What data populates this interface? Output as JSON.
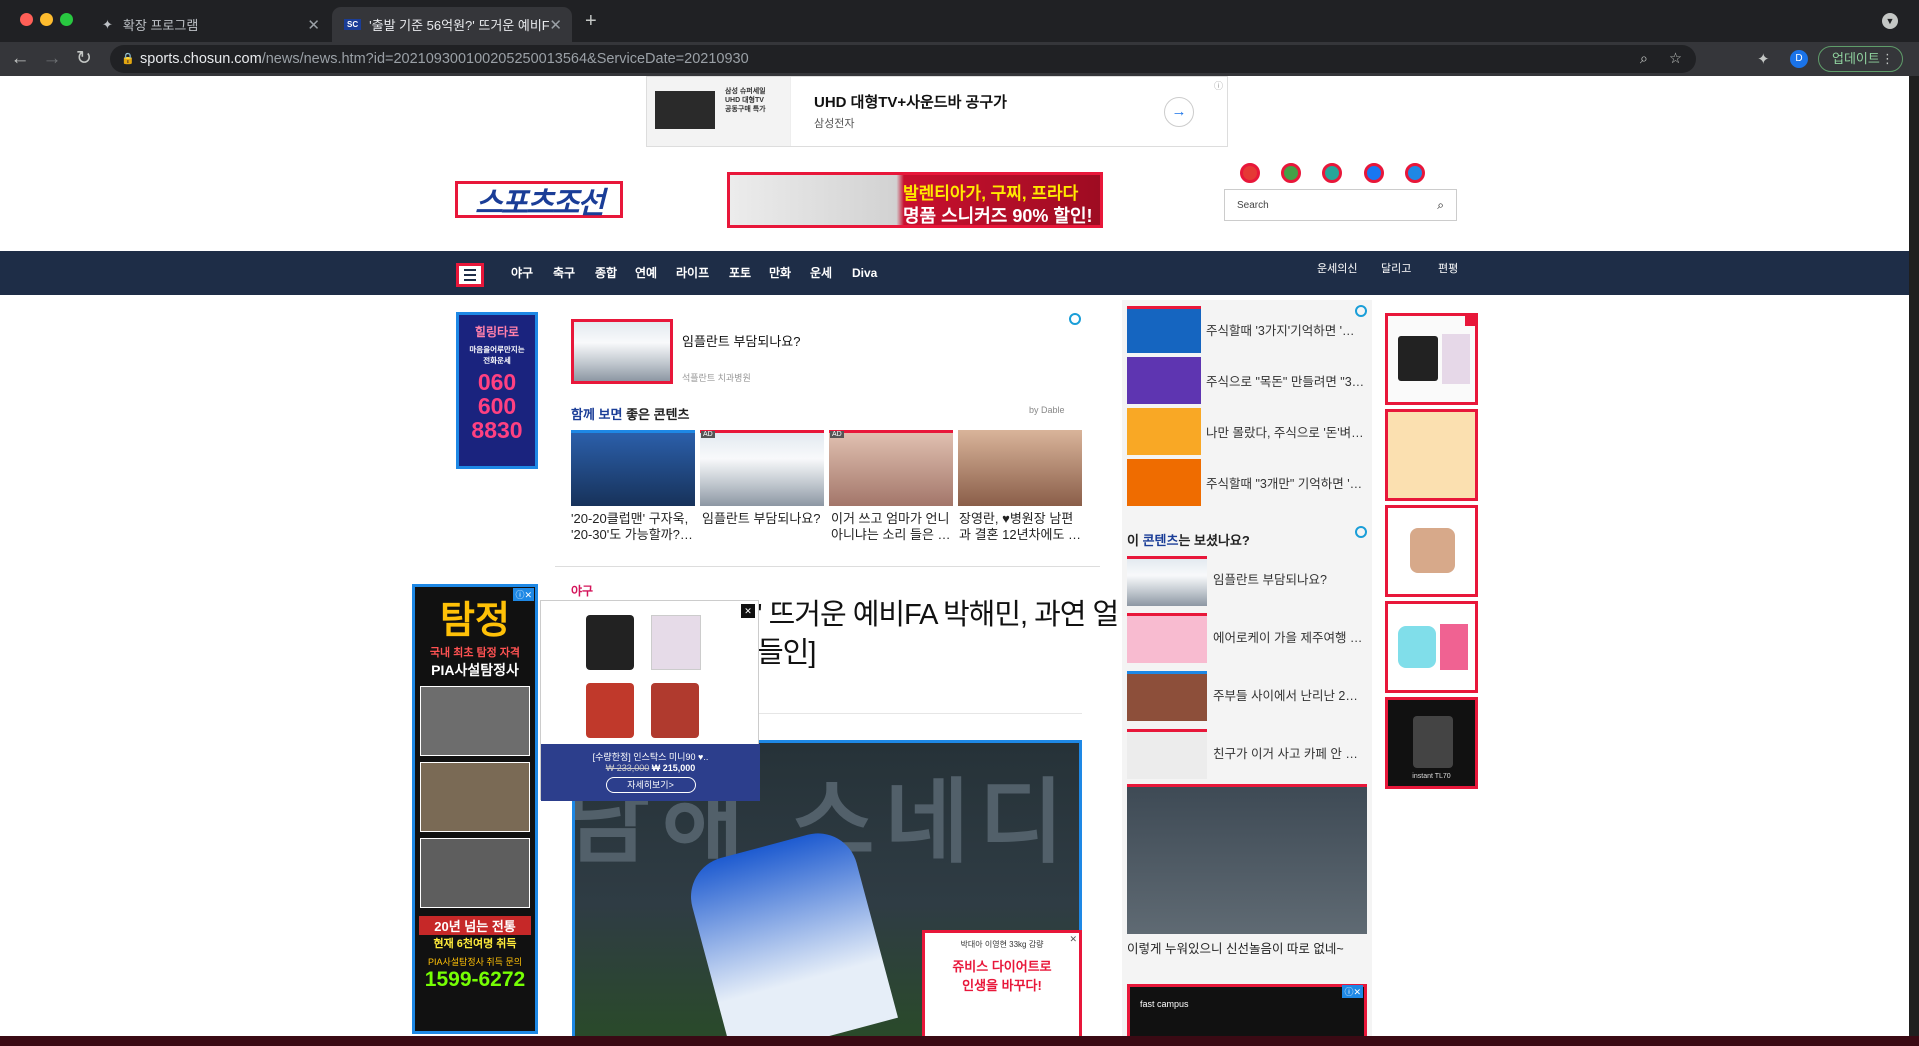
{
  "browser": {
    "tabs": [
      {
        "title": "확장 프로그램",
        "icon": "puzzle-icon"
      },
      {
        "title": "'출발 기준 56억원?' 뜨거운 예비FA",
        "icon": "sc-favicon"
      }
    ],
    "url_host": "sports.chosun.com",
    "url_path": "/news/news.htm?id=202109300100205250013564&ServiceDate=20210930",
    "update_label": "업데이트",
    "profile_letter": "D"
  },
  "top_ad": {
    "title": "UHD 대형TV+사운드바 공구가",
    "advertiser": "삼성전자",
    "thumb_lines": [
      "삼성 슈퍼세일",
      "UHD 대형TV",
      "공동구매 특가"
    ]
  },
  "header": {
    "logo_text": "스포츠조선",
    "banner_line1": "발렌티아가, 구찌, 프라다",
    "banner_line2": "명품 스니커즈 90% 할인!",
    "search_placeholder": "Search"
  },
  "nav": {
    "items": [
      "야구",
      "축구",
      "종합",
      "연예",
      "라이프",
      "포토",
      "만화",
      "운세",
      "Diva"
    ],
    "right_items": [
      "운세의신",
      "달리고",
      "편평"
    ]
  },
  "side_ad": {
    "title": "힐링타로",
    "subtitle": "마음을어루만지는 전화운세",
    "phone": [
      "060",
      "600",
      "8830"
    ]
  },
  "sponsored": {
    "title": "임플란트 부담되나요?",
    "source": "석플란트 치과병원"
  },
  "together": {
    "heading_accent": "함께 보면",
    "heading_rest": "좋은 콘텐츠",
    "by": "by Dable",
    "cards": [
      {
        "title": "'20-20클럽맨' 구자욱, '20-30'도 가능할까?…",
        "ad": false
      },
      {
        "title": "임플란트 부담되나요?",
        "ad": true
      },
      {
        "title": "이거 쓰고 엄마가 언니 아니냐는 소리 들은 …",
        "ad": true
      },
      {
        "title": "장영란, ♥병원장 남편과 결혼 12년차에도 …",
        "ad": false
      }
    ]
  },
  "article": {
    "category": "야구",
    "headline_line1": "' 뜨거운 예비FA 박해민, 과연 얼",
    "headline_line2": "들인]"
  },
  "popup": {
    "label": "[수량한정] 인스탁스 미니90 ♥..",
    "old_price": "₩ 233,000",
    "new_price": "₩ 215,000",
    "cta": "자세히보기>"
  },
  "left_ad": {
    "title": "탐정",
    "line1": "국내 최초 탐정 자격",
    "line2": "PIA사설탐정사",
    "line3": "20년 넘는 전통",
    "line4": "현재 6천여명 취득",
    "line5": "PIA사설탐정사 취득 문의",
    "phone": "1599-6272"
  },
  "inset_ad": {
    "caption": "박대아 이영현 33kg 감량",
    "title_line1": "쥬비스 다이어트로",
    "title_line2": "인생을 바꾸다!"
  },
  "right_list": [
    "주식할때 '3가지'기억하면 '…",
    "주식으로 \"목돈\" 만들려면 \"3…",
    "나만 몰랐다, 주식으로 '돈'벼…",
    "주식할때 \"3개만\" 기억하면 '…"
  ],
  "seen": {
    "heading_prefix": "이",
    "heading_accent": "콘텐츠",
    "heading_rest": "는 보셨나요?",
    "items": [
      "임플란트 부담되나요?",
      "에어로케이 가을 제주여행 …",
      "주부들 사이에서 난리난 2…",
      "친구가 이거 사고 카페 안 …"
    ],
    "feature_caption": "이렇게 누워있으니 신선놀음이 따로 없네~",
    "bottom_ad_label": "fast campus"
  },
  "far_right": {
    "last_label": "instant TL70"
  },
  "colors": {
    "nav_bg": "#1e2d47",
    "accent_red": "#e8173a",
    "accent_blue": "#1e88e5",
    "chrome_dark": "#202124"
  }
}
